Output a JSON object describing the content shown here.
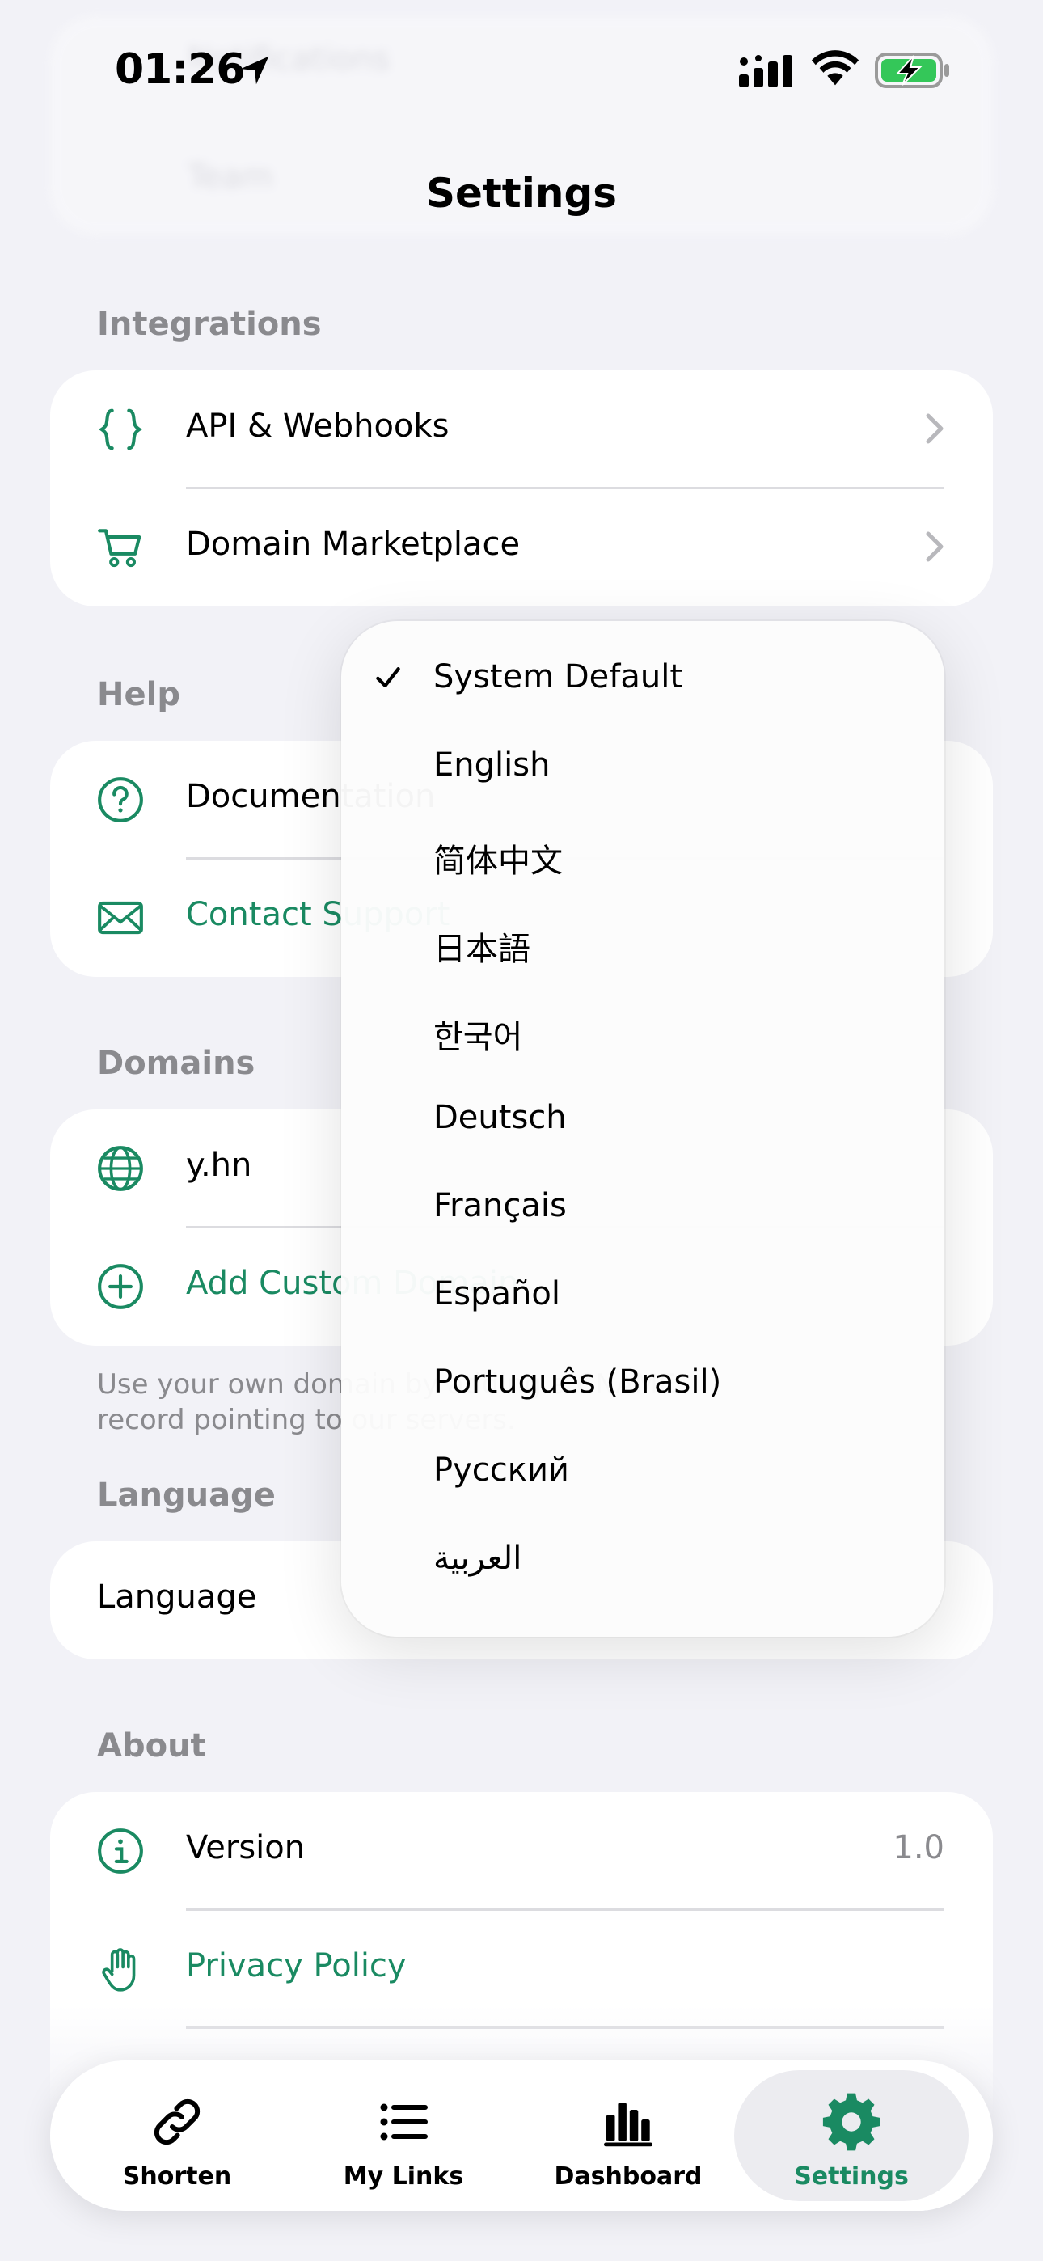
{
  "status_bar": {
    "time": "01:26"
  },
  "header": {
    "title": "Settings"
  },
  "ghost": {
    "row1": "Notifications",
    "row2": "Team"
  },
  "integrations": {
    "header": "Integrations",
    "items": [
      {
        "label": "API & Webhooks",
        "icon": "braces-icon"
      },
      {
        "label": "Domain Marketplace",
        "icon": "cart-icon"
      }
    ]
  },
  "help": {
    "header": "Help",
    "items": [
      {
        "label": "Documentation",
        "icon": "question-icon"
      },
      {
        "label": "Contact Support",
        "icon": "mail-icon"
      }
    ]
  },
  "domains": {
    "header": "Domains",
    "items": [
      {
        "label": "y.hn",
        "icon": "globe-icon"
      },
      {
        "label": "Add Custom Domain",
        "icon": "plus-circle-icon"
      }
    ],
    "footnote_line1": "Use your own domain by adding a CNAME",
    "footnote_line2": "record pointing to our servers."
  },
  "language": {
    "header": "Language",
    "row_label": "Language"
  },
  "about": {
    "header": "About",
    "items": [
      {
        "label": "Version",
        "value": "1.0",
        "icon": "info-icon"
      },
      {
        "label": "Privacy Policy",
        "icon": "hand-icon"
      }
    ]
  },
  "language_menu": {
    "selected": "System Default",
    "options": [
      "System Default",
      "English",
      "简体中文",
      "日本語",
      "한국어",
      "Deutsch",
      "Français",
      "Español",
      "Português (Brasil)",
      "Русский",
      "العربية"
    ]
  },
  "tabbar": {
    "tabs": [
      {
        "label": "Shorten",
        "icon": "link-icon"
      },
      {
        "label": "My Links",
        "icon": "list-icon"
      },
      {
        "label": "Dashboard",
        "icon": "bar-chart-icon"
      },
      {
        "label": "Settings",
        "icon": "gear-icon"
      }
    ],
    "active": "Settings"
  },
  "colors": {
    "accent": "#1a8a62",
    "background": "#f2f2f7",
    "secondary_text": "#8a8a8e"
  }
}
